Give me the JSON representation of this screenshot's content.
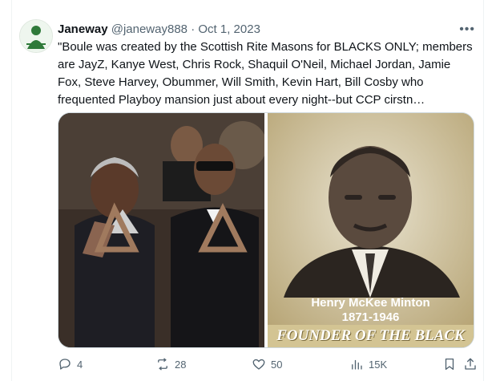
{
  "tweet": {
    "display_name": "Janeway",
    "handle": "@janeway888",
    "separator": "·",
    "date": "Oct 1, 2023",
    "more_label": "•••",
    "text": "\"Boule was created by the Scottish Rite Masons for BLACKS ONLY; members are JayZ, Kanye West, Chris Rock, Shaquil O'Neil, Michael Jordan, Jamie Fox, Steve Harvey, Obummer, Will Smith, Kevin Hart, Bill Cosby who frequented Playboy mansion just about every night--but CCP cirstn…",
    "media": {
      "photo2_name": "Henry McKee Minton",
      "photo2_years": "1871-1946",
      "photo2_banner": "FOUNDER OF THE BLACK"
    }
  },
  "actions": {
    "replies": "4",
    "reposts": "28",
    "likes": "50",
    "views": "15K"
  },
  "icons": {
    "reply": "reply-icon",
    "repost": "repost-icon",
    "like": "heart-icon",
    "views": "views-icon",
    "bookmark": "bookmark-icon",
    "share": "share-icon"
  },
  "colors": {
    "muted": "#536471",
    "text": "#0f1419",
    "border": "#cfd9de"
  }
}
